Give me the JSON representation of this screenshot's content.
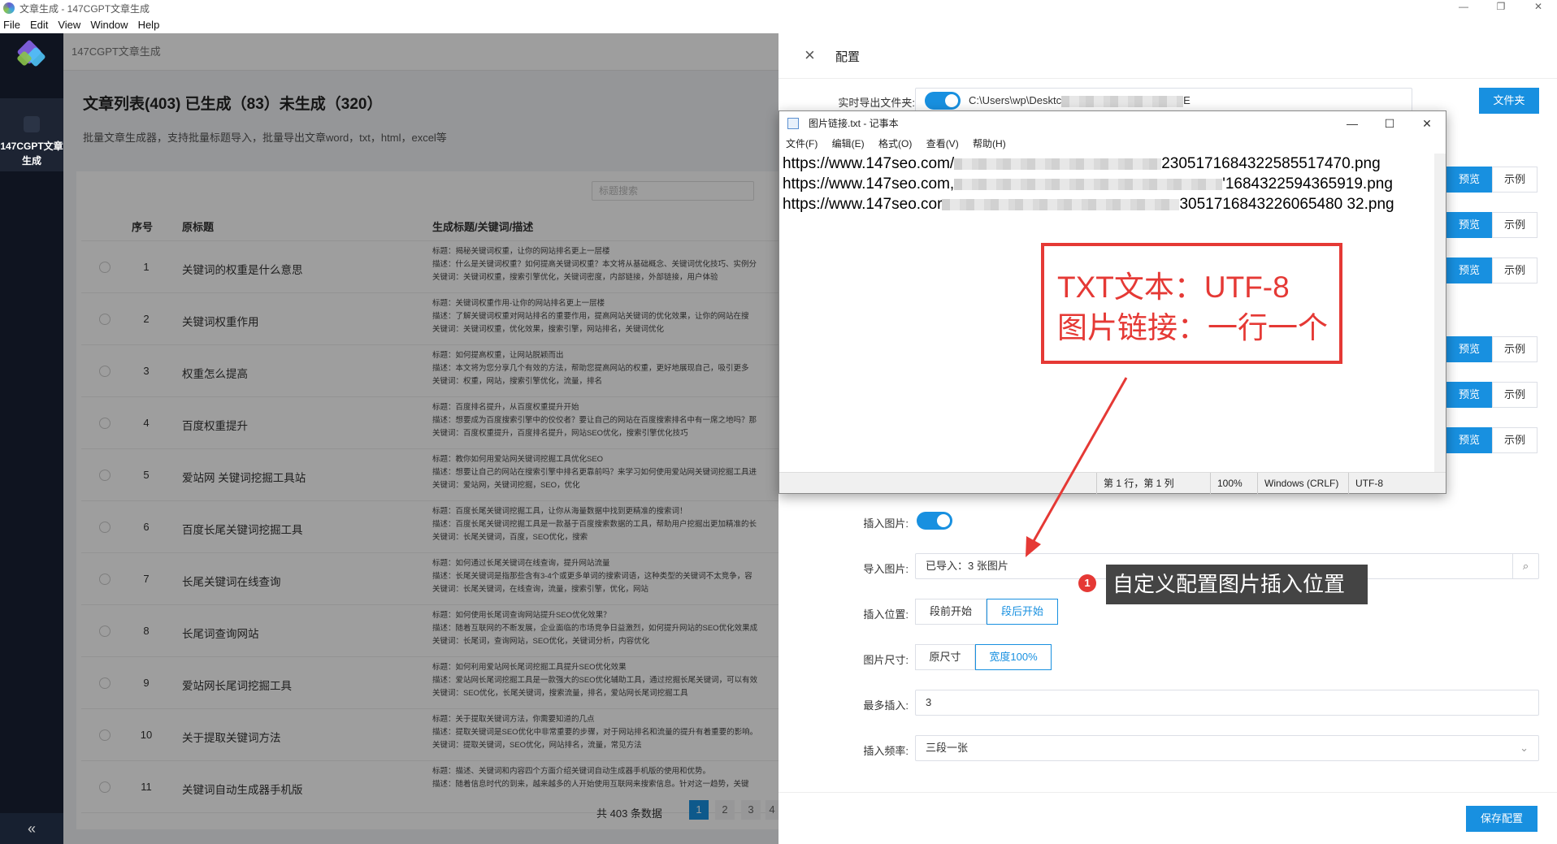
{
  "window": {
    "title": "文章生成 - 147CGPT文章生成",
    "menu": [
      "File",
      "Edit",
      "View",
      "Window",
      "Help"
    ],
    "controls": [
      "—",
      "❐",
      "✕"
    ]
  },
  "rail": {
    "active_item": "147CGPT文章生成",
    "collapse_label": "«"
  },
  "main": {
    "breadcrumb": "147CGPT文章生成",
    "heading": "文章列表(403) 已生成（83）未生成（320）",
    "subheading": "批量文章生成器，支持批量标题导入，批量导出文章word，txt，html，excel等",
    "search_placeholder": "标题搜索",
    "columns": [
      "序号",
      "原标题",
      "生成标题/关键词/描述"
    ],
    "rows": [
      {
        "idx": "1",
        "title": "关键词的权重是什么意思",
        "l1": "标题：揭秘关键词权重，让你的网站排名更上一层楼",
        "l2": "描述：什么是关键词权重？如何提高关键词权重？本文将从基础概念、关键词优化技巧、实例分",
        "l3": "关键词：关键词权重，搜索引擎优化，关键词密度，内部链接，外部链接，用户体验"
      },
      {
        "idx": "2",
        "title": "关键词权重作用",
        "l1": "标题：关键词权重作用-让你的网站排名更上一层楼",
        "l2": "描述：了解关键词权重对网站排名的重要作用，提高网站关键词的优化效果，让你的网站在搜",
        "l3": "关键词：关键词权重，优化效果，搜索引擎，网站排名，关键词优化"
      },
      {
        "idx": "3",
        "title": "权重怎么提高",
        "l1": "标题：如何提高权重，让网站脱颖而出",
        "l2": "描述：本文将为您分享几个有效的方法，帮助您提高网站的权重，更好地展现自己，吸引更多",
        "l3": "关键词：权重，网站，搜索引擎优化，流量，排名"
      },
      {
        "idx": "4",
        "title": "百度权重提升",
        "l1": "标题：百度排名提升，从百度权重提升开始",
        "l2": "描述：想要成为百度搜索引擎中的佼佼者？要让自己的网站在百度搜索排名中有一席之地吗？那",
        "l3": "关键词：百度权重提升，百度排名提升，网站SEO优化，搜索引擎优化技巧"
      },
      {
        "idx": "5",
        "title": "爱站网 关键词挖掘工具站",
        "l1": "标题：教你如何用爱站网关键词挖掘工具优化SEO",
        "l2": "描述：想要让自己的网站在搜索引擎中排名更靠前吗？来学习如何使用爱站网关键词挖掘工具进",
        "l3": "关键词：爱站网，关键词挖掘，SEO，优化"
      },
      {
        "idx": "6",
        "title": "百度长尾关键词挖掘工具",
        "l1": "标题：百度长尾关键词挖掘工具，让你从海量数据中找到更精准的搜索词！",
        "l2": "描述：百度长尾关键词挖掘工具是一款基于百度搜索数据的工具，帮助用户挖掘出更加精准的长",
        "l3": "关键词：长尾关键词，百度，SEO优化，搜索"
      },
      {
        "idx": "7",
        "title": "长尾关键词在线查询",
        "l1": "标题：如何通过长尾关键词在线查询，提升网站流量",
        "l2": "描述：长尾关键词是指那些含有3-4个或更多单词的搜索词语，这种类型的关键词不太竞争，容",
        "l3": "关键词：长尾关键词，在线查询，流量，搜索引擎，优化，网站"
      },
      {
        "idx": "8",
        "title": "长尾词查询网站",
        "l1": "标题：如何使用长尾词查询网站提升SEO优化效果？",
        "l2": "描述：随着互联网的不断发展，企业面临的市场竞争日益激烈，如何提升网站的SEO优化效果成",
        "l3": "关键词：长尾词，查询网站，SEO优化，关键词分析，内容优化"
      },
      {
        "idx": "9",
        "title": "爱站网长尾词挖掘工具",
        "l1": "标题：如何利用爱站网长尾词挖掘工具提升SEO优化效果",
        "l2": "描述：爱站网长尾词挖掘工具是一款强大的SEO优化辅助工具，通过挖掘长尾关键词，可以有效",
        "l3": "关键词：SEO优化，长尾关键词，搜索流量，排名，爱站网长尾词挖掘工具"
      },
      {
        "idx": "10",
        "title": "关于提取关键词方法",
        "l1": "标题：关于提取关键词方法，你需要知道的几点",
        "l2": "描述：提取关键词是SEO优化中非常重要的步骤，对于网站排名和流量的提升有着重要的影响。",
        "l3": "关键词：提取关键词，SEO优化，网站排名，流量，常见方法"
      },
      {
        "idx": "11",
        "title": "关键词自动生成器手机版",
        "l1": "标题：描述、关键词和内容四个方面介绍关键词自动生成器手机版的使用和优势。",
        "l2": "描述：随着信息时代的到来，越来越多的人开始使用互联网来搜索信息。针对这一趋势，关键",
        "l3": ""
      }
    ],
    "total_text": "共 403 条数据",
    "pages": [
      "1",
      "2",
      "3",
      "4"
    ],
    "active_page": "1"
  },
  "drawer": {
    "title": "配置",
    "export_label": "实时导出文件夹:",
    "export_path_prefix": "C:\\Users\\wp\\Desktc",
    "export_path_suffix": "E",
    "folder_button": "文件夹",
    "preview_label": "预览",
    "example_label": "示例",
    "insert_label": "插入图片:",
    "import_label": "导入图片:",
    "import_value": "已导入：3 张图片",
    "position_label": "插入位置:",
    "position_options": [
      "段前开始",
      "段后开始"
    ],
    "position_selected": "段后开始",
    "size_label": "图片尺寸:",
    "size_options": [
      "原尺寸",
      "宽度100%"
    ],
    "size_selected": "宽度100%",
    "max_label": "最多插入:",
    "max_value": "3",
    "freq_label": "插入频率:",
    "freq_value": "三段一张",
    "save_button": "保存配置"
  },
  "notepad": {
    "title": "图片链接.txt - 记事本",
    "menu": [
      "文件(F)",
      "编辑(E)",
      "格式(O)",
      "查看(V)",
      "帮助(H)"
    ],
    "lines": [
      {
        "prefix": "https://www.147seo.com/",
        "suffix": "2305171684322585517470.png"
      },
      {
        "prefix": "https://www.147seo.com,",
        "suffix": "'1684322594365919.png"
      },
      {
        "prefix": "https://www.147seo.cor",
        "suffix": "3051716843226065480 32.png"
      }
    ],
    "status": [
      "第 1 行，第 1 列",
      "100%",
      "Windows (CRLF)",
      "UTF-8"
    ]
  },
  "annotations": {
    "box_line1": "TXT文本：UTF-8",
    "box_line2": "图片链接：一行一个",
    "badge": "1",
    "tip": "自定义配置图片插入位置",
    "accent": "#e53935"
  }
}
